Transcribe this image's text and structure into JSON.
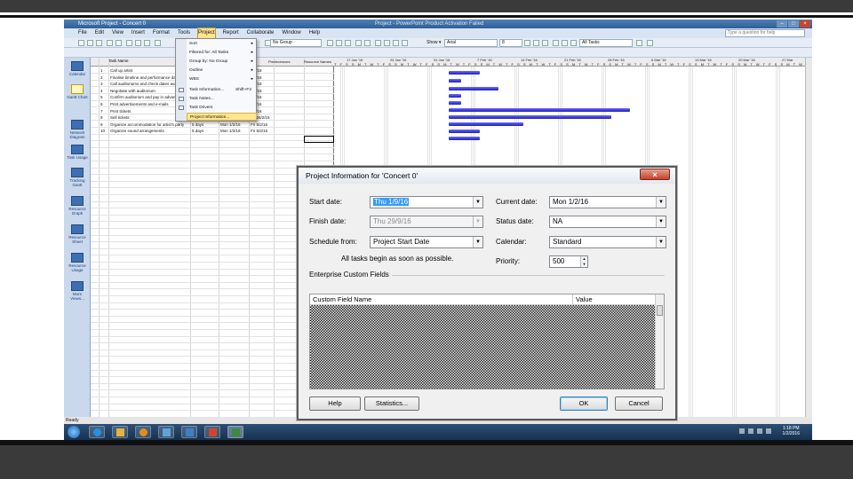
{
  "app": {
    "title": "Microsoft Project - Concert 0",
    "title_sub": "Project - PowerPoint Product Activation Failed",
    "window_controls": [
      "–",
      "□",
      "×"
    ]
  },
  "menubar": {
    "items": [
      "File",
      "Edit",
      "View",
      "Insert",
      "Format",
      "Tools",
      "Project",
      "Report",
      "Collaborate",
      "Window",
      "Help"
    ],
    "help_placeholder": "Type a question for help"
  },
  "toolbar": {
    "group_value": "No Group",
    "show_label": "Show ▾",
    "font_value": "Arial",
    "size_value": "8",
    "filter_value": "All Tasks"
  },
  "viewbar": {
    "items": [
      "Calendar",
      "Gantt Chart",
      "Network Diagram",
      "Task Usage",
      "Tracking Gantt",
      "Resource Graph",
      "Resource Sheet",
      "Resource Usage",
      "More Views..."
    ]
  },
  "grid": {
    "header_task": "Task Name",
    "header_extra": [
      "Predecessors",
      "Resource Names"
    ],
    "rows": [
      {
        "id": "1",
        "name": "Call up artist",
        "finish": "1/2/16"
      },
      {
        "id": "2",
        "name": "Finalise timeline and performance dates",
        "finish": "6/2/16"
      },
      {
        "id": "3",
        "name": "Call auditoriums and check dates availability",
        "finish": "5/2/16"
      },
      {
        "id": "4",
        "name": "Negotiate with auditorium",
        "finish": "3/2/16"
      },
      {
        "id": "5",
        "name": "Confirm auditorium and pay in advance",
        "finish": "3/2/16"
      },
      {
        "id": "6",
        "name": "Print advertisements and e-mails",
        "finish": "1/2/16"
      },
      {
        "id": "7",
        "name": "Print tickets",
        "finish": "8/2/16"
      },
      {
        "id": "8",
        "name": "Sell tickets",
        "duration": "10 days",
        "start": "Mon 15/2/16",
        "finish": "Fri 26/2/16"
      },
      {
        "id": "9",
        "name": "Organize accommodation for artist's party",
        "duration": "5 days",
        "start": "Mon 1/2/16",
        "finish": "Fri 5/2/16"
      },
      {
        "id": "10",
        "name": "Organize sound arrangements",
        "duration": "5 days",
        "start": "Mon 1/2/16",
        "finish": "Fri 5/2/16"
      }
    ]
  },
  "gantt": {
    "weeks": [
      "17 Jan '16",
      "24 Jan '16",
      "31 Jan '16",
      "7 Feb '16",
      "14 Feb '16",
      "21 Feb '16",
      "28 Feb '16",
      "6 Mar '16",
      "13 Mar '16",
      "20 Mar '16",
      "27 Mar"
    ],
    "day_letters": "T F S S M T W T F S S M T W T F S S M T W T F S S M T W T F S S M T W T F S S M T W T F S S M T W T F S S M T W T F S S M T W T F S S M T W T F S S M T W T F S"
  },
  "statusbar": {
    "text": "Ready"
  },
  "project_menu": {
    "items": [
      {
        "label": "Sort",
        "arrow": "▸"
      },
      {
        "label": "Filtered for: All Tasks",
        "arrow": "▸"
      },
      {
        "label": "Group by: No Group",
        "arrow": "▸"
      },
      {
        "label": "Outline",
        "arrow": "▸"
      },
      {
        "label": "WBS",
        "arrow": "▸"
      },
      {
        "label": "Task Information...",
        "shortcut": "Shift+F2"
      },
      {
        "label": "Task Notes..."
      },
      {
        "label": "Task Drivers"
      },
      {
        "label": "Project Information..."
      }
    ]
  },
  "dialog": {
    "title": "Project Information for 'Concert 0'",
    "close": "×",
    "start_date_label": "Start date:",
    "start_date_value": "Thu 1/9/16",
    "finish_date_label": "Finish date:",
    "finish_date_value": "Thu 29/9/16",
    "schedule_from_label": "Schedule from:",
    "schedule_from_value": "Project Start Date",
    "schedule_note": "All tasks begin as soon as possible.",
    "current_date_label": "Current date:",
    "current_date_value": "Mon 1/2/16",
    "status_date_label": "Status date:",
    "status_date_value": "NA",
    "calendar_label": "Calendar:",
    "calendar_value": "Standard",
    "priority_label": "Priority:",
    "priority_value": "500",
    "custom_fields_label": "Enterprise Custom Fields",
    "col_field_name": "Custom Field Name",
    "col_value": "Value",
    "help_button": "Help",
    "statistics_button": "Statistics...",
    "ok_button": "OK",
    "cancel_button": "Cancel"
  },
  "taskbar": {
    "clock_time": "1:18 PM",
    "clock_date": "1/2/2016"
  }
}
